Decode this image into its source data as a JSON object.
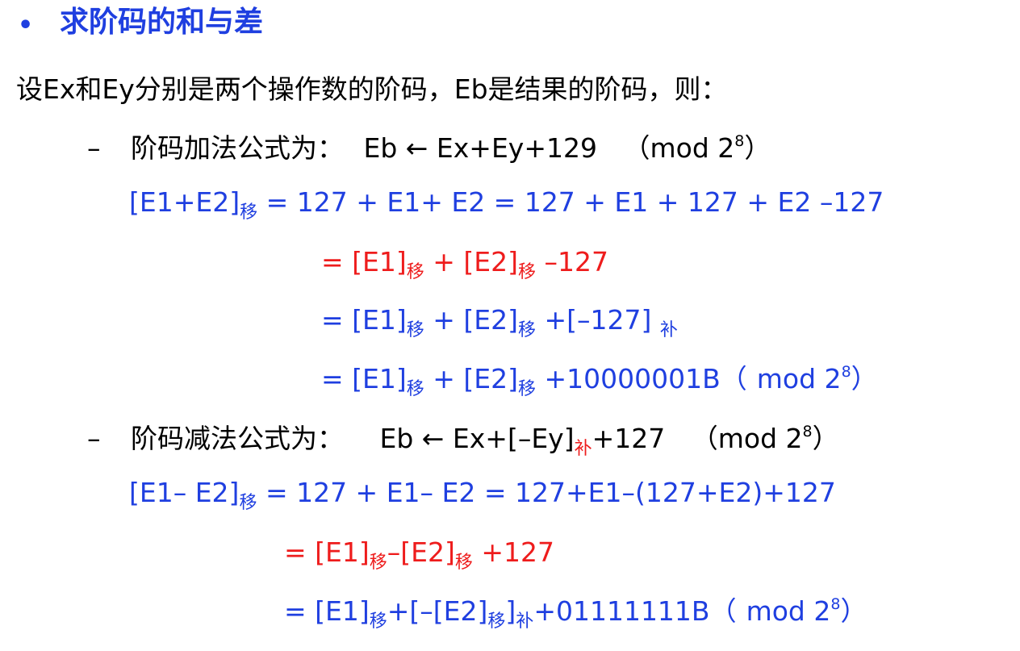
{
  "heading": {
    "bullet": "•",
    "title": "求阶码的和与差"
  },
  "intro": "设Ex和Ey分别是两个操作数的阶码，Eb是结果的阶码，则：",
  "addition": {
    "dash": "–",
    "label": "阶码加法公式为：",
    "formula_main": "Eb ← Ex+Ey+129",
    "paren_open": "（",
    "mod_text": "mod 2",
    "mod_exp": "8",
    "paren_close": "）",
    "line1": {
      "left": "[E1+E2]",
      "sub": "移",
      "right": " = 127 + E1+ E2 = 127 + E1 + 127 + E2 –127"
    },
    "line2": {
      "eq": "= ",
      "a": "[E1]",
      "sub_a": "移",
      "mid": " + ",
      "b": "[E2]",
      "sub_b": "移",
      "tail": " –127"
    },
    "line3": {
      "eq": "= ",
      "a": "[E1]",
      "sub_a": "移",
      "mid": " + ",
      "b": "[E2]",
      "sub_b": "移",
      "tail": " +[–127] ",
      "sub_tail": "补"
    },
    "line4": {
      "eq": "= ",
      "a": "[E1]",
      "sub_a": "移",
      "mid": " + ",
      "b": "[E2]",
      "sub_b": "移",
      "tail": " +10000001B（",
      "mod_text": "mod 2",
      "mod_exp": "8",
      "paren_close": "）"
    }
  },
  "subtraction": {
    "dash": "–",
    "label": "阶码减法公式为：",
    "formula_a": "Eb ← Ex+[–Ey]",
    "formula_sub": "补",
    "formula_b": "+127",
    "paren_open": "（",
    "mod_text": "mod 2",
    "mod_exp": "8",
    "paren_close": "）",
    "line1": {
      "left": "[E1– E2]",
      "sub": "移",
      "right": " = 127 + E1– E2 = 127+E1–(127+E2)+127"
    },
    "line2": {
      "eq": "= ",
      "a": "[E1]",
      "sub_a": "移",
      "mid": "–",
      "b": "[E2]",
      "sub_b": "移",
      "tail": " +127"
    },
    "line3": {
      "eq": "= ",
      "a": "[E1]",
      "sub_a": "移",
      "mid": "+[–",
      "b": "[E2]",
      "sub_b": "移",
      "close": "]",
      "sub_close": "补",
      "tail": "+01111111B（",
      "mod_text": "mod 2",
      "mod_exp": "8",
      "paren_close": "）"
    }
  }
}
